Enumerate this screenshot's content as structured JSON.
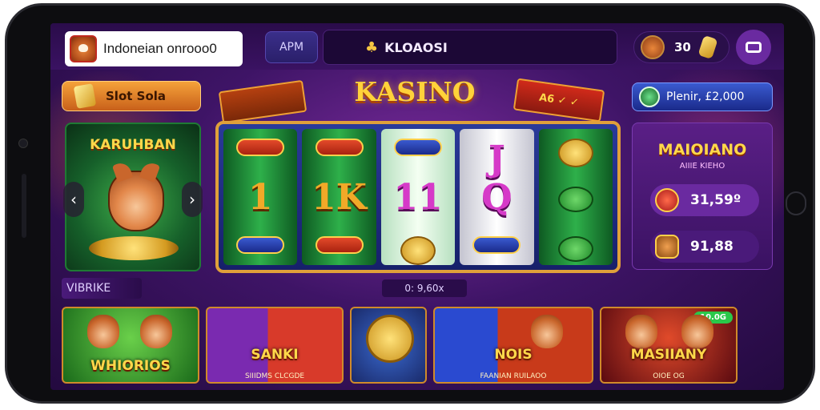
{
  "header": {
    "language_label": "Indoneian onrooo0",
    "apm_label": "APM",
    "search_text": "KLOAOSI",
    "coin_value": "30"
  },
  "promo": {
    "slot_label": "Slot Sola",
    "hero_title": "KARUHBAN"
  },
  "machine": {
    "title": "KASINO",
    "right_banner": "A6 ✓ ✓",
    "reels": [
      {
        "mid": "1",
        "style": "green"
      },
      {
        "mid": "1K",
        "style": "green"
      },
      {
        "mid": "11",
        "style": "light"
      },
      {
        "mid": "Q",
        "top": "J",
        "style": "white"
      },
      {
        "style": "green"
      }
    ]
  },
  "right_panel": {
    "player_label": "Plenir, £2,000",
    "card_title": "MAIOIANO",
    "card_subtitle": "AIIIE KIEHO",
    "stat1": "31,59º",
    "stat2": "91,88"
  },
  "strip": {
    "label": "VIBRIKE",
    "pill": "0: 9,60x"
  },
  "games": [
    {
      "name": "WHIORIOS",
      "sub": ""
    },
    {
      "name": "SANKI",
      "sub": "SIIIDMS CLCGDE"
    },
    {
      "name": "",
      "sub": ""
    },
    {
      "name": "NOIS",
      "sub": "FAANIAN RUILAOO"
    },
    {
      "name": "MASIIANY",
      "sub": "OIOE OG",
      "badge": "10.0G"
    }
  ],
  "icons": [
    "shiba-flag-icon",
    "search-slot-icon",
    "coin-icon",
    "menu-icon",
    "gold-bar-icon",
    "chevron-left-icon",
    "chevron-right-icon"
  ],
  "colors": {
    "gold": "#ffd23a",
    "purple": "#3e1466",
    "green": "#2eb04a"
  }
}
